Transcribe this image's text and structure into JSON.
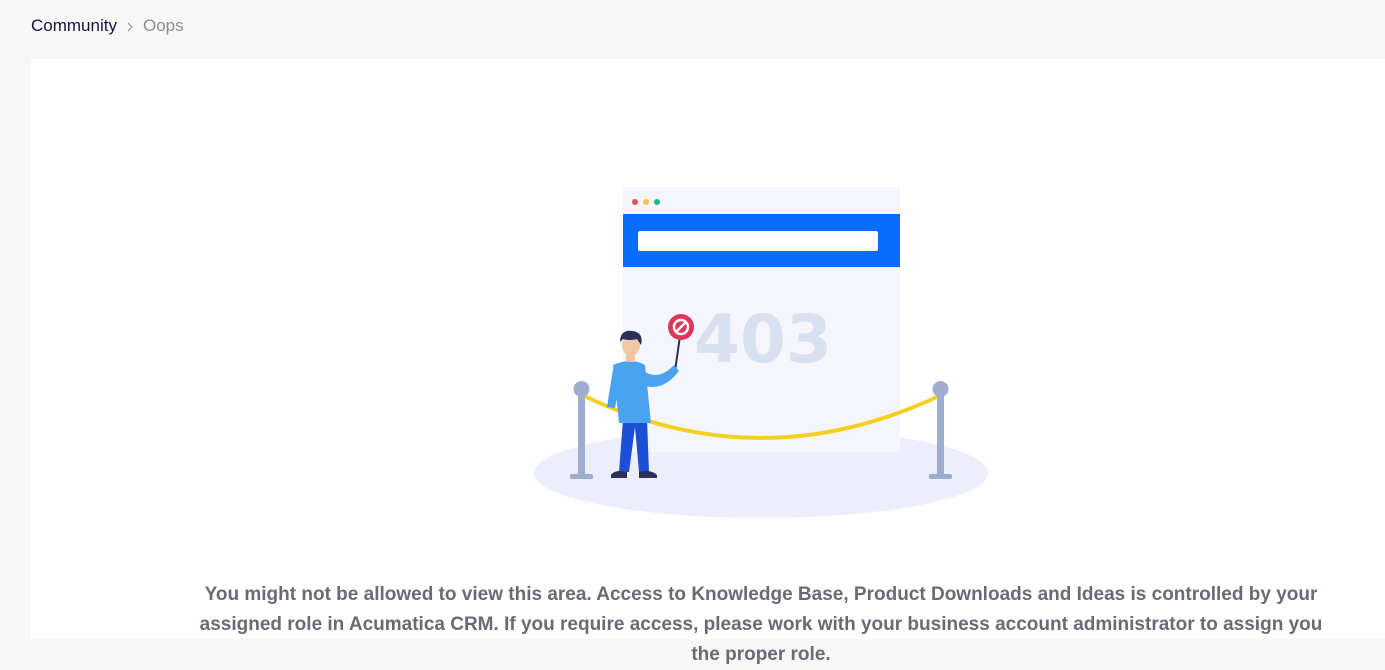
{
  "breadcrumb": {
    "home_label": "Community",
    "separator": ">",
    "current_label": "Oops"
  },
  "illustration": {
    "code_text": "403",
    "icon": "no-entry-sign-icon"
  },
  "message": {
    "text": "You might not be allowed to view this area. Access to Knowledge Base, Product Downloads and Ideas is controlled by your assigned role in Acumatica CRM. If you require access, please work with your business account administrator to assign you the proper role."
  },
  "colors": {
    "page_background": "#f7f7f7",
    "card_background": "#ffffff",
    "browser_header": "#0a6cff",
    "error_code": "#d9e0f0",
    "rope": "#f5cf1f",
    "stanchion": "#9eaccf",
    "sign": "#e0345b",
    "person_shirt": "#4aa3f0",
    "person_pants": "#1c4fd8",
    "text": "#686b75"
  }
}
